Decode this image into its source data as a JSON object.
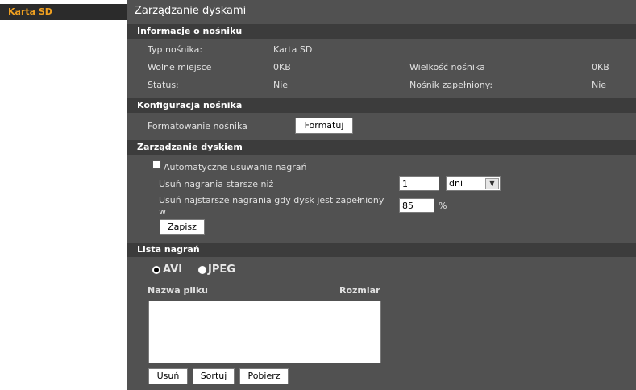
{
  "sidebar": {
    "items": [
      {
        "label": "Karta SD",
        "active": true
      }
    ]
  },
  "page_title": "Zarządzanie dyskami",
  "media_info": {
    "section_title": "Informacje o nośniku",
    "type_label": "Typ nośnika:",
    "type_value": "Karta SD",
    "free_label": "Wolne miejsce",
    "free_value": "0KB",
    "size_label": "Wielkość nośnika",
    "size_value": "0KB",
    "status_label": "Status:",
    "status_value": "Nie",
    "full_label": "Nośnik zapełniony:",
    "full_value": "Nie"
  },
  "media_config": {
    "section_title": "Konfiguracja nośnika",
    "format_label": "Formatowanie nośnika",
    "format_button": "Formatuj"
  },
  "disk_management": {
    "section_title": "Zarządzanie dyskiem",
    "auto_delete_label": "Automatyczne usuwanie nagrań",
    "auto_delete_checked": false,
    "delete_older_label": "Usuń nagrania starsze niż",
    "delete_older_value": "1",
    "delete_older_unit": "dni",
    "delete_oldest_label_line1": "Usuń najstarsze nagrania gdy dysk jest zapełniony",
    "delete_oldest_label_line2": "w",
    "delete_oldest_value": "85",
    "percent_sign": "%",
    "save_button": "Zapisz"
  },
  "recordings": {
    "section_title": "Lista nagrań",
    "format_options": [
      "AVI",
      "JPEG"
    ],
    "selected_format": "AVI",
    "col_filename": "Nazwa pliku",
    "col_size": "Rozmiar",
    "delete_button": "Usuń",
    "sort_button": "Sortuj",
    "download_button": "Pobierz"
  },
  "colors": {
    "main_bg": "#515151",
    "section_bg": "#3c3c3c",
    "sidebar_active_text": "#f0a020",
    "sidebar_active_bg": "#2b2b2b"
  }
}
